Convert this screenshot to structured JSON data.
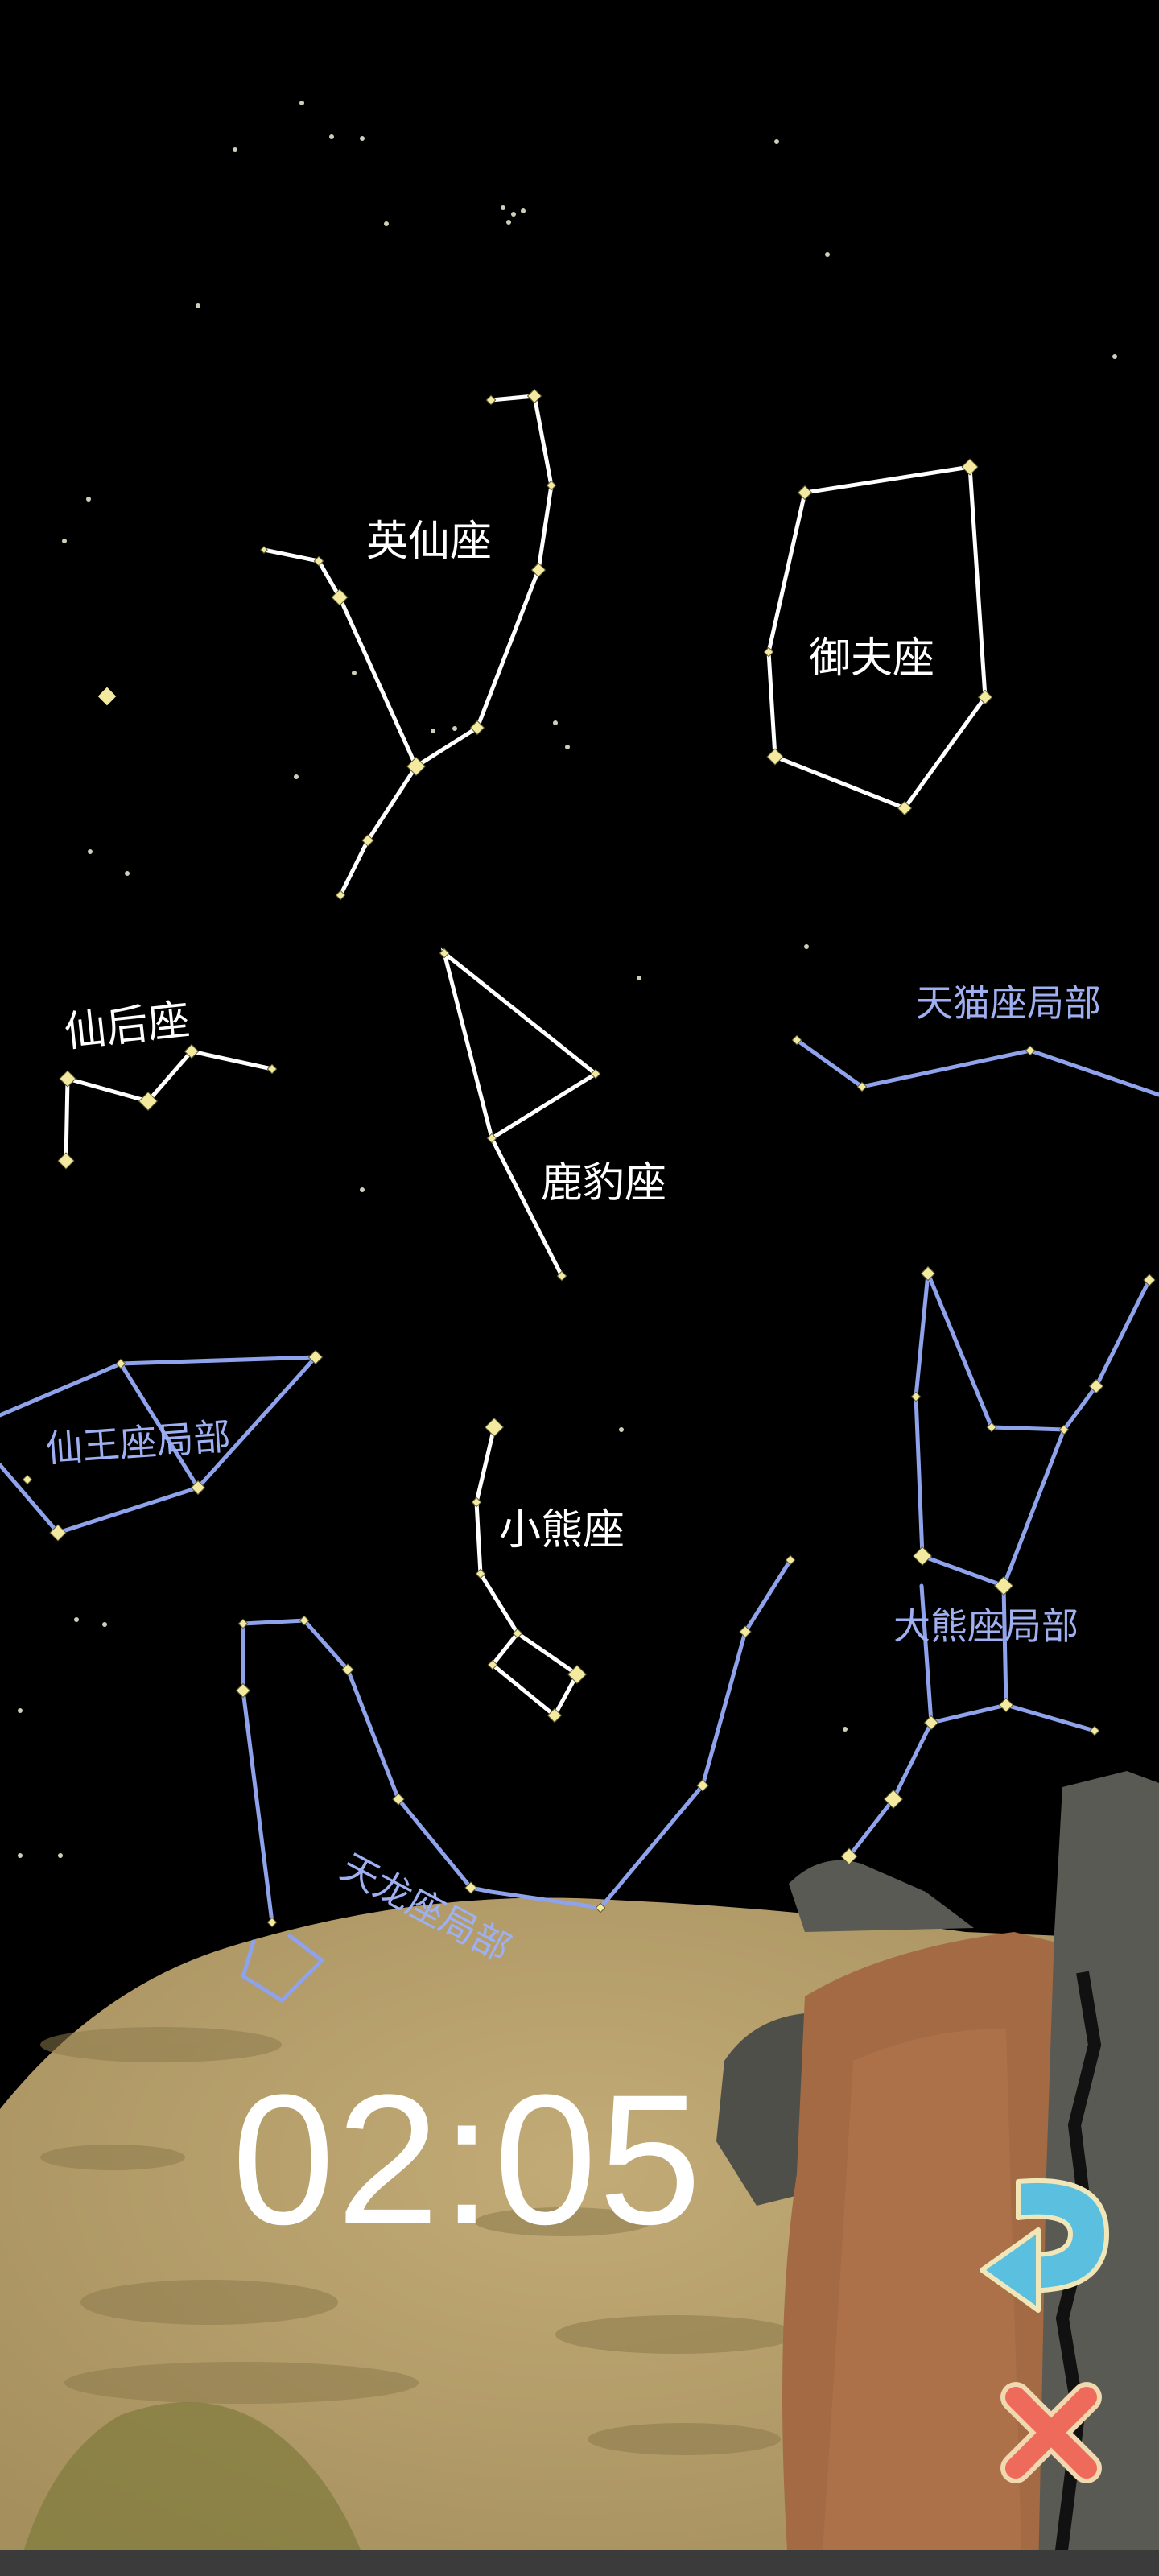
{
  "timer": {
    "value": "02:05"
  },
  "constellations": {
    "perseus": "英仙座",
    "auriga": "御夫座",
    "cassiopeia": "仙后座",
    "camelopardalis": "鹿豹座",
    "lynx_part": "天猫座局部",
    "cepheus_part": "仙王座局部",
    "ursa_minor": "小熊座",
    "ursa_major_part": "大熊座局部",
    "draco_part": "天龙座局部"
  },
  "buttons": {
    "undo_icon": "undo-arrow-icon",
    "close_icon": "close-x-icon"
  },
  "colors": {
    "sky": "#000000",
    "line_white": "#ffffff",
    "line_blue": "#8fa2ec",
    "star": "#f3eaa0",
    "ground": "#b39d6a",
    "cliff": "#a36a44",
    "rock": "#5a5a55",
    "undo": "#5bbfe0",
    "close": "#ee6a5a"
  }
}
